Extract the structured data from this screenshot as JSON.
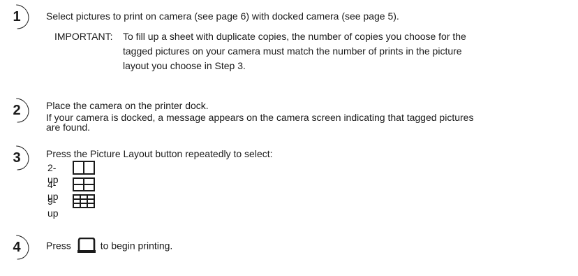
{
  "steps": [
    {
      "number": "1",
      "text": "Select pictures to print on camera (see page 6) with docked camera (see page 5).",
      "note_label": "IMPORTANT:",
      "note_lines": [
        "To fill up a sheet with duplicate copies, the number of copies you choose for the",
        "tagged pictures on your camera must match the number of prints in the picture",
        "layout you choose in Step 3."
      ]
    },
    {
      "number": "2",
      "line1": "Place the camera on the printer dock.",
      "line2a": "If your camera is docked, a message appears on the camera screen indicating that tagged pictures",
      "line2b": "are found."
    },
    {
      "number": "3",
      "text": "Press the Picture Layout button repeatedly to select:",
      "layouts": [
        {
          "label": "2-up",
          "icon": "two-up-layout-icon"
        },
        {
          "label": "4-up",
          "icon": "four-up-layout-icon"
        },
        {
          "label": "9-up",
          "icon": "nine-up-layout-icon"
        }
      ]
    },
    {
      "number": "4",
      "before": "Press",
      "icon": "print-button-icon",
      "after": "to begin printing."
    }
  ]
}
